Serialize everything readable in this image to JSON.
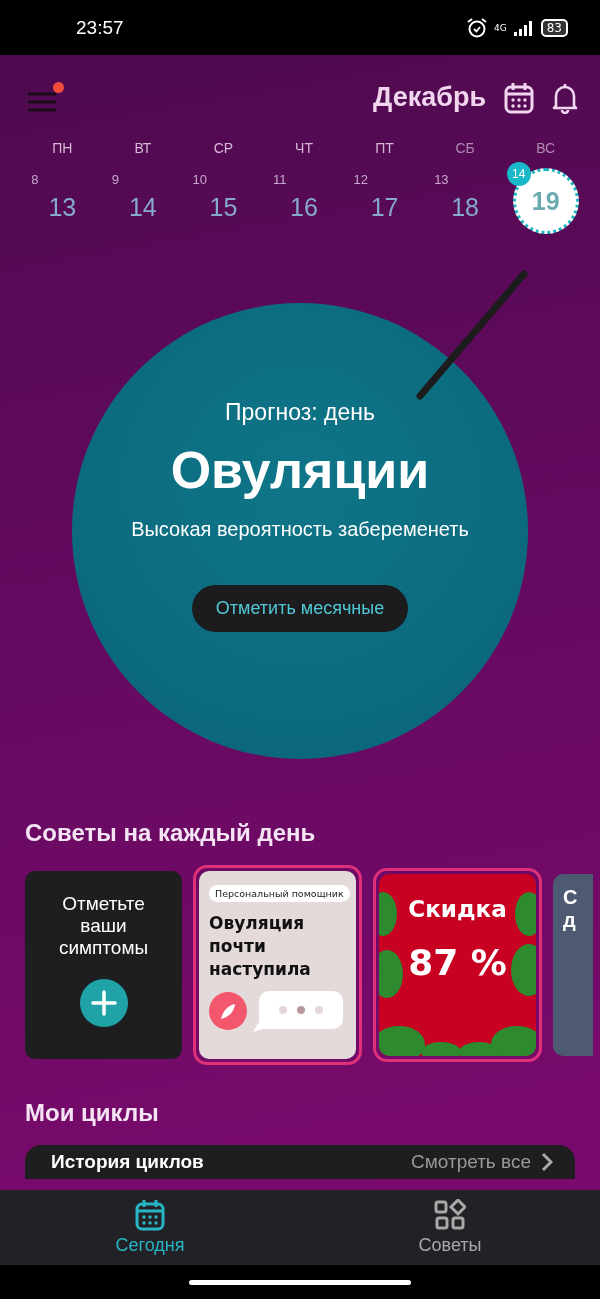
{
  "status_bar": {
    "time": "23:57",
    "network": "4G",
    "battery": "83"
  },
  "header": {
    "menu_notification": true,
    "month": "Декабрь"
  },
  "week": [
    {
      "weekday": "ПН",
      "cycle_day": "8",
      "date": "13",
      "weekend": false,
      "selected": false
    },
    {
      "weekday": "ВТ",
      "cycle_day": "9",
      "date": "14",
      "weekend": false,
      "selected": false
    },
    {
      "weekday": "СР",
      "cycle_day": "10",
      "date": "15",
      "weekend": false,
      "selected": false
    },
    {
      "weekday": "ЧТ",
      "cycle_day": "11",
      "date": "16",
      "weekend": false,
      "selected": false
    },
    {
      "weekday": "ПТ",
      "cycle_day": "12",
      "date": "17",
      "weekend": false,
      "selected": false
    },
    {
      "weekday": "СБ",
      "cycle_day": "13",
      "date": "18",
      "weekend": true,
      "selected": false
    },
    {
      "weekday": "ВС",
      "cycle_day": "14",
      "date": "19",
      "weekend": true,
      "selected": true
    }
  ],
  "forecast": {
    "label": "Прогноз: день",
    "title": "Овуляции",
    "subtitle": "Высокая вероятность забеременеть",
    "button": "Отметить месячные"
  },
  "tips": {
    "title": "Советы на каждый день",
    "cards": [
      {
        "kind": "action",
        "highlighted": false,
        "lines": [
          "Отметьте",
          "ваши",
          "симптомы"
        ]
      },
      {
        "kind": "chat",
        "highlighted": true,
        "tag": "Персональный помощник",
        "lines": [
          "Овуляция",
          "почти",
          "наступила"
        ]
      },
      {
        "kind": "sale",
        "highlighted": true,
        "lines": [
          "Скидка",
          "87 %"
        ]
      },
      {
        "kind": "partial",
        "highlighted": false,
        "lines": [
          "С",
          "д"
        ]
      }
    ]
  },
  "cycles": {
    "title": "Мои циклы",
    "row_title": "История циклов",
    "row_link": "Смотреть все"
  },
  "tabs": [
    {
      "kind": "calendar",
      "label": "Сегодня",
      "selected": true
    },
    {
      "kind": "grid",
      "label": "Советы",
      "selected": false
    }
  ]
}
